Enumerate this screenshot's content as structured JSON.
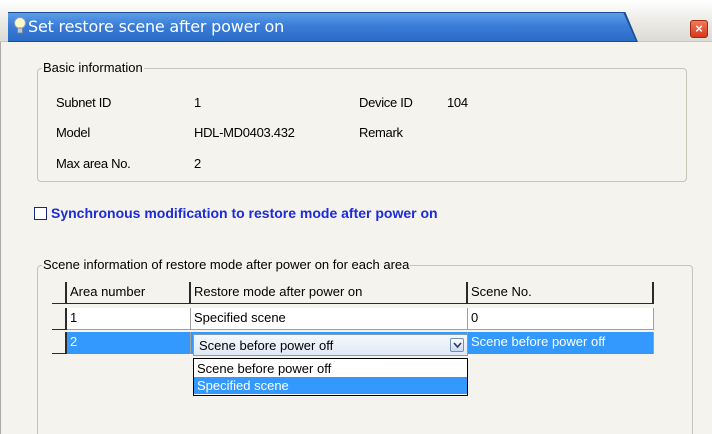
{
  "window": {
    "title": "Set restore scene after power on",
    "close_symbol": "×",
    "title_icon": "bulb-icon"
  },
  "basic": {
    "group_title": "Basic information",
    "subnet_label": "Subnet ID",
    "subnet_value": "1",
    "device_label": "Device ID",
    "device_value": "104",
    "model_label": "Model",
    "model_value": "HDL-MD0403.432",
    "remark_label": "Remark",
    "max_area_label": "Max area No.",
    "max_area_value": "2"
  },
  "sync": {
    "label": "Synchronous modification to restore mode after power on",
    "checked": false
  },
  "scene": {
    "group_title": "Scene information of restore mode after power on for each area",
    "columns": [
      "Area number",
      "Restore mode after power on",
      "Scene No."
    ],
    "rows": [
      {
        "area": "1",
        "mode": "Specified scene",
        "scene": "0"
      },
      {
        "area": "2",
        "mode": "Scene before power off",
        "scene": "Scene before power off"
      }
    ],
    "combo_value": "Scene before power off",
    "dropdown_options": [
      "Scene before power off",
      "Specified scene"
    ],
    "dropdown_highlighted": "Specified scene"
  },
  "colors": {
    "title_blue": "#3a7dd8",
    "selection_blue": "#3399ff",
    "sync_text_blue": "#1c2ad8",
    "close_red": "#d8381a"
  }
}
